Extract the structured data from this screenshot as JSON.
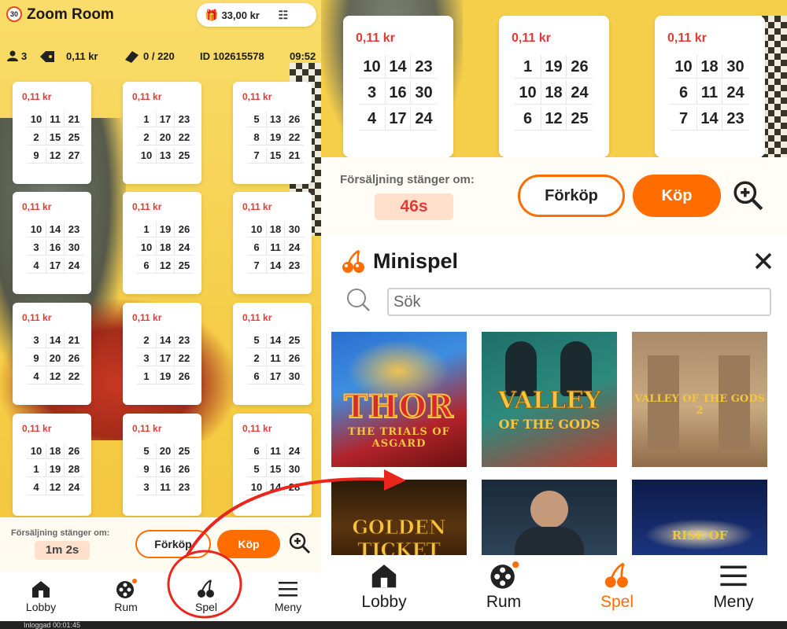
{
  "left": {
    "room_badge": "30",
    "room_title": "Zoom Room",
    "balance": "33,00 kr",
    "stats": {
      "players": "3",
      "ticket_price": "0,11 kr",
      "tickets": "0 / 220",
      "game_id": "ID 102615578",
      "time": "09:52"
    },
    "tickets": [
      {
        "price": "0,11 kr",
        "numbers": [
          "10",
          "11",
          "21",
          "2",
          "15",
          "25",
          "9",
          "12",
          "27"
        ]
      },
      {
        "price": "0,11 kr",
        "numbers": [
          "1",
          "17",
          "23",
          "2",
          "20",
          "22",
          "10",
          "13",
          "25"
        ]
      },
      {
        "price": "0,11 kr",
        "numbers": [
          "5",
          "13",
          "26",
          "8",
          "19",
          "22",
          "7",
          "15",
          "21"
        ]
      },
      {
        "price": "0,11 kr",
        "numbers": [
          "10",
          "14",
          "23",
          "3",
          "16",
          "30",
          "4",
          "17",
          "24"
        ]
      },
      {
        "price": "0,11 kr",
        "numbers": [
          "1",
          "19",
          "26",
          "10",
          "18",
          "24",
          "6",
          "12",
          "25"
        ]
      },
      {
        "price": "0,11 kr",
        "numbers": [
          "10",
          "18",
          "30",
          "6",
          "11",
          "24",
          "7",
          "14",
          "23"
        ]
      },
      {
        "price": "0,11 kr",
        "numbers": [
          "3",
          "14",
          "21",
          "9",
          "20",
          "26",
          "4",
          "12",
          "22"
        ]
      },
      {
        "price": "0,11 kr",
        "numbers": [
          "2",
          "14",
          "23",
          "3",
          "17",
          "22",
          "1",
          "19",
          "26"
        ]
      },
      {
        "price": "0,11 kr",
        "numbers": [
          "5",
          "14",
          "25",
          "2",
          "11",
          "26",
          "6",
          "17",
          "30"
        ]
      },
      {
        "price": "0,11 kr",
        "numbers": [
          "10",
          "18",
          "26",
          "1",
          "19",
          "28",
          "4",
          "12",
          "24"
        ]
      },
      {
        "price": "0,11 kr",
        "numbers": [
          "5",
          "20",
          "25",
          "9",
          "16",
          "26",
          "3",
          "11",
          "23"
        ]
      },
      {
        "price": "0,11 kr",
        "numbers": [
          "6",
          "11",
          "24",
          "5",
          "15",
          "30",
          "10",
          "14",
          "28"
        ]
      }
    ],
    "sales_label": "Försäljning stänger om:",
    "timer": "1m 2s",
    "forkop": "Förköp",
    "kop": "Köp",
    "nav": {
      "lobby": "Lobby",
      "rum": "Rum",
      "spel": "Spel",
      "meny": "Meny"
    }
  },
  "right": {
    "tickets": [
      {
        "price": "0,11 kr",
        "numbers": [
          "10",
          "14",
          "23",
          "3",
          "16",
          "30",
          "4",
          "17",
          "24"
        ]
      },
      {
        "price": "0,11 kr",
        "numbers": [
          "1",
          "19",
          "26",
          "10",
          "18",
          "24",
          "6",
          "12",
          "25"
        ]
      },
      {
        "price": "0,11 kr",
        "numbers": [
          "10",
          "18",
          "30",
          "6",
          "11",
          "24",
          "7",
          "14",
          "23"
        ]
      }
    ],
    "sales_label": "Försäljning stänger om:",
    "timer": "46s",
    "forkop": "Förköp",
    "kop": "Köp",
    "minispel": {
      "title": "Minispel",
      "search_placeholder": "Sök",
      "games": [
        {
          "name": "THOR",
          "sub": "THE TRIALS OF ASGARD"
        },
        {
          "name": "VALLEY",
          "sub": "OF THE GODS"
        },
        {
          "name": "VALLEY OF THE GODS 2"
        },
        {
          "name": "GOLDEN TICKET"
        },
        {
          "name": ""
        },
        {
          "name": "RISE OF"
        }
      ]
    },
    "nav": {
      "lobby": "Lobby",
      "rum": "Rum",
      "spel": "Spel",
      "meny": "Meny"
    }
  },
  "status_bar": "Inloggad 00:01:45",
  "colors": {
    "accent": "#ff6d00",
    "price_red": "#e53935",
    "annotation_red": "#e8261c",
    "background_yellow": "#f6cf4a"
  }
}
